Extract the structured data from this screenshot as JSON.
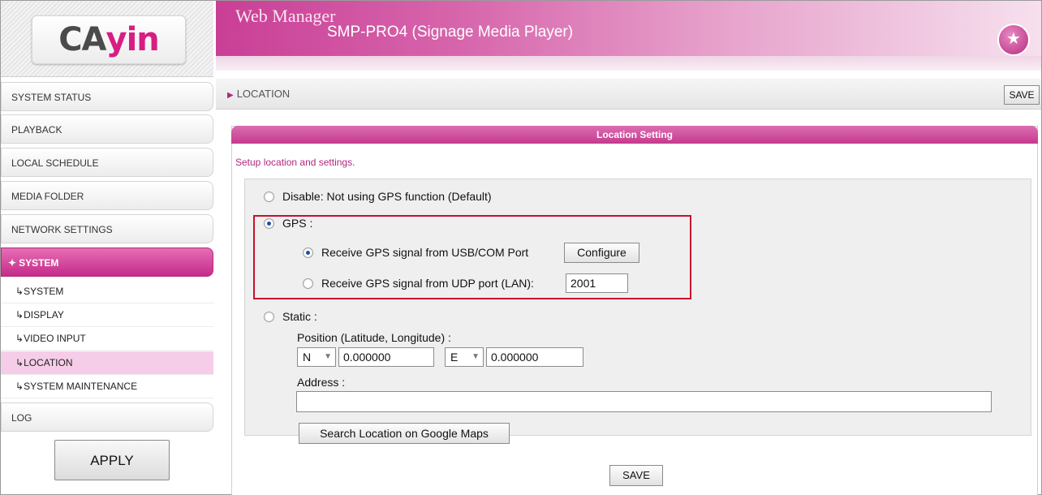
{
  "brand": {
    "logo_part1": "CA",
    "logo_part2": "yin"
  },
  "header": {
    "app_name": "Web Manager",
    "device_name": "SMP-PRO4 (Signage Media Player)"
  },
  "sidebar": {
    "items": [
      {
        "label": "SYSTEM STATUS"
      },
      {
        "label": "PLAYBACK"
      },
      {
        "label": "LOCAL SCHEDULE"
      },
      {
        "label": "MEDIA FOLDER"
      },
      {
        "label": "NETWORK SETTINGS"
      },
      {
        "label": "SYSTEM"
      },
      {
        "label": "LOG"
      }
    ],
    "active_item": "SYSTEM",
    "sub_items": [
      {
        "label": "SYSTEM"
      },
      {
        "label": "DISPLAY"
      },
      {
        "label": "VIDEO INPUT"
      },
      {
        "label": "LOCATION"
      },
      {
        "label": "SYSTEM MAINTENANCE"
      }
    ],
    "current_sub_item": "LOCATION",
    "apply_label": "APPLY"
  },
  "page": {
    "title": "LOCATION",
    "save_label": "SAVE"
  },
  "panel": {
    "title": "Location Setting",
    "description": "Setup location and settings.",
    "options": {
      "disable_label": "Disable: Not using GPS function (Default)",
      "gps_label": "GPS :",
      "gps_usb_label": "Receive GPS signal from USB/COM Port",
      "configure_label": "Configure",
      "gps_udp_label": "Receive GPS signal from UDP port (LAN):",
      "udp_port_value": "2001",
      "static_label": "Static :"
    },
    "selected_mode": "GPS",
    "selected_gps_source": "USB/COM Port",
    "position_label": "Position (Latitude, Longitude) :",
    "lat_dir": "N",
    "lat_value": "0.000000",
    "lon_dir": "E",
    "lon_value": "0.000000",
    "address_label": "Address :",
    "address_value": "",
    "google_maps_label": "Search Location on Google Maps",
    "save_label": "SAVE"
  },
  "colors": {
    "accent": "#c93f96",
    "highlight_box": "#c8102e",
    "selected_row": "#f6cde8"
  }
}
